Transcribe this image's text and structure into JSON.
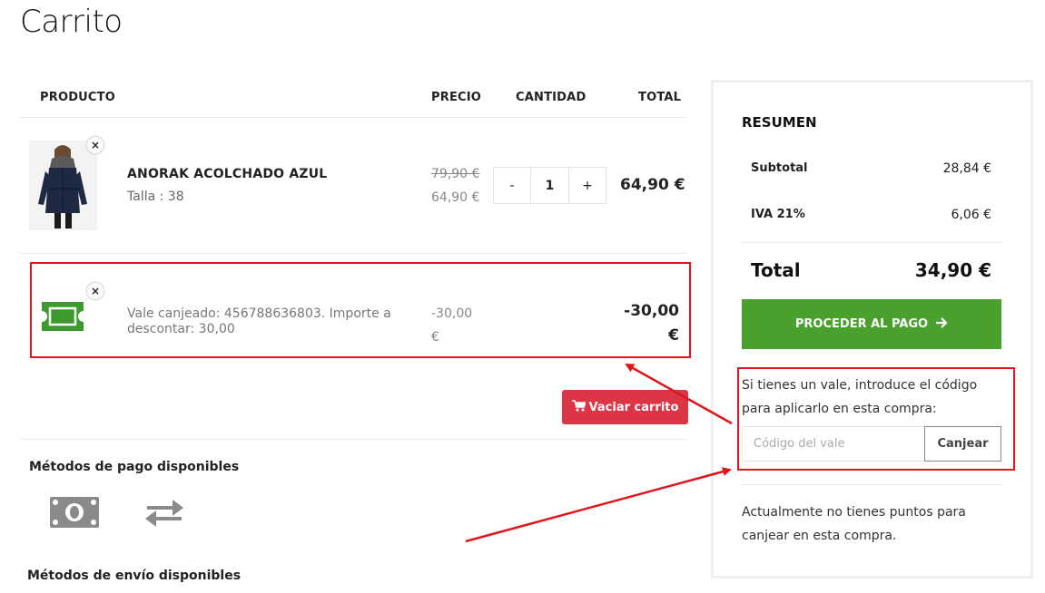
{
  "page": {
    "title": "Carrito"
  },
  "cart": {
    "headers": {
      "product": "PRODUCTO",
      "price": "PRECIO",
      "quantity": "CANTIDAD",
      "total": "TOTAL"
    },
    "item": {
      "name": "ANORAK ACOLCHADO AZUL",
      "attribute": "Talla : 38",
      "price_old": "79,90 €",
      "price_new": "64,90 €",
      "qty_minus": "-",
      "qty_plus": "+",
      "quantity": "1",
      "total": "64,90 €"
    },
    "voucher": {
      "description": "Vale canjeado: 456788636803. Importe a descontar: 30,00",
      "price": "-30,00 €",
      "total": "-30,00 €"
    },
    "remove_symbol": "×",
    "empty_button": "Vaciar carrito",
    "payment_title": "Métodos de pago disponibles",
    "shipping_title": "Métodos de envío disponibles",
    "icons": [
      "cart-icon",
      "cash-icon",
      "transfer-icon",
      "ticket-icon",
      "arrow-right-icon"
    ]
  },
  "summary": {
    "title": "RESUMEN",
    "subtotal_label": "Subtotal",
    "subtotal_value": "28,84 €",
    "tax_label": "IVA 21%",
    "tax_value": "6,06 €",
    "total_label": "Total",
    "total_value": "34,90 €",
    "checkout_button": "PROCEDER AL PAGO",
    "voucher_prompt": "Si tienes un vale, introduce el código para aplicarlo en esta compra:",
    "voucher_placeholder": "Código del vale",
    "voucher_value": "",
    "redeem_button": "Canjear",
    "points_text": "Actualmente no tienes puntos para canjear en esta compra."
  },
  "colors": {
    "checkout_green": "#4aa02c",
    "empty_red": "#dc3545",
    "annotation_red": "#e0141b",
    "ticket_green": "#3d9a2e"
  }
}
